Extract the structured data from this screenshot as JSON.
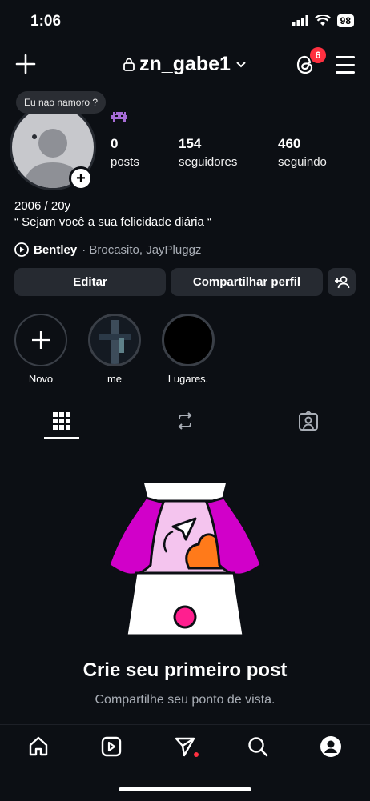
{
  "status": {
    "time": "1:06",
    "battery": "98"
  },
  "header": {
    "username": "zn_gabe1",
    "notif_count": "6"
  },
  "profile": {
    "note": "Eu nao namoro ?",
    "stats": [
      {
        "num": "0",
        "label": "posts"
      },
      {
        "num": "154",
        "label": "seguidores"
      },
      {
        "num": "460",
        "label": "seguindo"
      }
    ],
    "bio_line1": "2006 / 20y",
    "bio_line2": "“ Sejam você a sua felicidade diária “",
    "music_artist": "Bentley",
    "music_others": "· Brocasito, JayPluggz"
  },
  "buttons": {
    "edit": "Editar",
    "share": "Compartilhar perfil"
  },
  "highlights": [
    {
      "label": "Novo"
    },
    {
      "label": "me"
    },
    {
      "label": "Lugares."
    }
  ],
  "empty_state": {
    "title": "Crie seu primeiro post",
    "subtitle": "Compartilhe seu ponto de vista."
  },
  "colors": {
    "background": "#0c0f14",
    "button": "#262a31",
    "accent": "#ff3040",
    "magenta": "#d100c9"
  },
  "icons": [
    "plus-icon",
    "lock-icon",
    "chevron-down-icon",
    "threads-icon",
    "menu-icon",
    "add-user-icon",
    "grid-icon",
    "reels-icon",
    "tagged-icon",
    "home-icon",
    "reels-nav-icon",
    "send-icon",
    "search-icon",
    "profile-icon"
  ]
}
